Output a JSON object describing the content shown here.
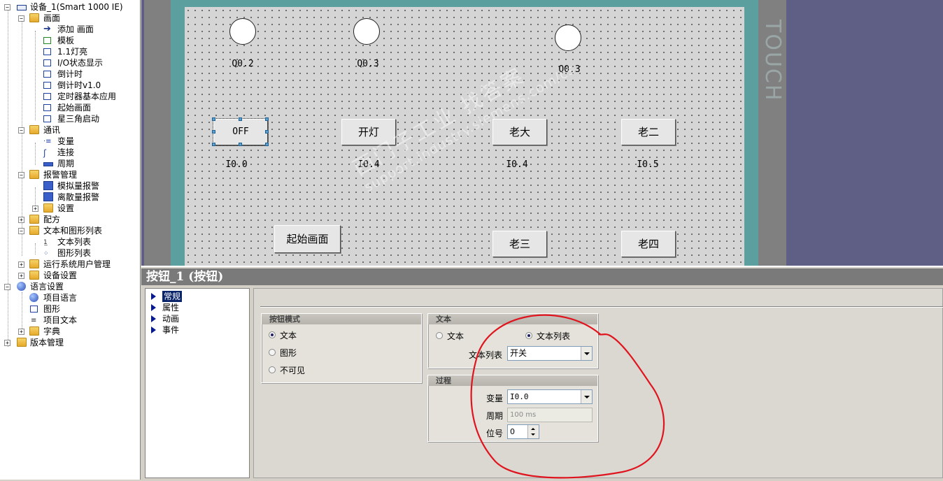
{
  "tree": {
    "items": [
      {
        "label": "设备_1(Smart 1000 IE)",
        "icon": "device-icon"
      },
      {
        "label": "画面",
        "icon": "folder-icon"
      },
      {
        "label": "添加 画面",
        "icon": "add-screen-icon"
      },
      {
        "label": "模板",
        "icon": "template-icon"
      },
      {
        "label": "1.1灯亮",
        "icon": "screen-icon"
      },
      {
        "label": "I/O状态显示",
        "icon": "screen-icon"
      },
      {
        "label": "倒计时",
        "icon": "screen-icon"
      },
      {
        "label": "倒计时v1.0",
        "icon": "screen-icon"
      },
      {
        "label": "定时器基本应用",
        "icon": "screen-icon"
      },
      {
        "label": "起始画面",
        "icon": "screen-icon"
      },
      {
        "label": "星三角启动",
        "icon": "screen-icon"
      },
      {
        "label": "通讯",
        "icon": "folder-icon"
      },
      {
        "label": "变量",
        "icon": "tags-icon"
      },
      {
        "label": "连接",
        "icon": "connection-icon"
      },
      {
        "label": "周期",
        "icon": "cycle-icon"
      },
      {
        "label": "报警管理",
        "icon": "folder-icon"
      },
      {
        "label": "模拟量报警",
        "icon": "analog-alarm-icon"
      },
      {
        "label": "离散量报警",
        "icon": "discrete-alarm-icon"
      },
      {
        "label": "设置",
        "icon": "settings-folder-icon"
      },
      {
        "label": "配方",
        "icon": "folder-icon"
      },
      {
        "label": "文本和图形列表",
        "icon": "folder-icon"
      },
      {
        "label": "文本列表",
        "icon": "text-list-icon"
      },
      {
        "label": "图形列表",
        "icon": "graphic-list-icon"
      },
      {
        "label": "运行系统用户管理",
        "icon": "folder-icon"
      },
      {
        "label": "设备设置",
        "icon": "folder-icon"
      },
      {
        "label": "语言设置",
        "icon": "globe-icon"
      },
      {
        "label": "项目语言",
        "icon": "globe-icon"
      },
      {
        "label": "图形",
        "icon": "graphics-icon"
      },
      {
        "label": "项目文本",
        "icon": "project-text-icon"
      },
      {
        "label": "字典",
        "icon": "folder-icon"
      },
      {
        "label": "版本管理",
        "icon": "version-icon"
      }
    ]
  },
  "hmi": {
    "brand": "TOUCH",
    "lamps": [
      {
        "address": "Q0.2"
      },
      {
        "address": "Q0.3"
      },
      {
        "address": "Q0.3"
      }
    ],
    "buttons": [
      {
        "label": "OFF",
        "address": "I0.0"
      },
      {
        "label": "开灯",
        "address": "I0.4"
      },
      {
        "label": "老大",
        "address": "I0.4"
      },
      {
        "label": "老二",
        "address": "I0.5"
      },
      {
        "label": "起始画面"
      },
      {
        "label": "老三"
      },
      {
        "label": "老四"
      }
    ]
  },
  "properties": {
    "title": "按钮_1 (按钮)",
    "nav": [
      "常规",
      "属性",
      "动画",
      "事件"
    ],
    "button_mode": {
      "title": "按钮模式",
      "options": [
        "文本",
        "图形",
        "不可见"
      ],
      "selected": "文本"
    },
    "text": {
      "title": "文本",
      "options": [
        "文本",
        "文本列表"
      ],
      "selected": "文本列表",
      "list_label": "文本列表",
      "list_value": "开关"
    },
    "process": {
      "title": "过程",
      "tag_label": "变量",
      "tag_value": "I0.0",
      "cycle_label": "周期",
      "cycle_value": "100 ms",
      "bit_label": "位号",
      "bit_value": "0"
    },
    "annotation_color": "#e0141e"
  },
  "watermark": {
    "line1": "西门子工业  找答案",
    "line2": "support.industry.siemens.com/cs"
  }
}
